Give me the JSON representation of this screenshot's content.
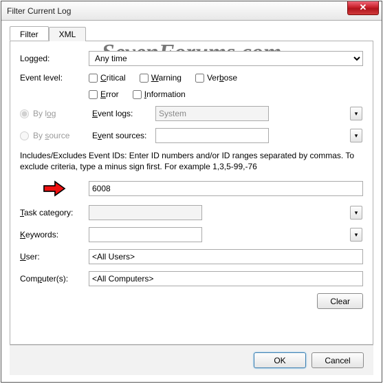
{
  "window": {
    "title": "Filter Current Log"
  },
  "watermark": "SevenForums.com",
  "tabs": {
    "filter": "Filter",
    "xml": "XML"
  },
  "labels": {
    "logged": "Logged:",
    "event_level": "Event level:",
    "by_log": "By log",
    "by_source": "By source",
    "event_logs": "Event logs:",
    "event_sources": "Event sources:",
    "task_category": "Task category:",
    "keywords": "Keywords:",
    "user": "User:",
    "computers": "Computer(s):"
  },
  "logged_value": "Any time",
  "levels": {
    "critical": "Critical",
    "warning": "Warning",
    "verbose": "Verbose",
    "error": "Error",
    "information": "Information"
  },
  "event_logs_value": "System",
  "event_sources_value": "",
  "help_text": "Includes/Excludes Event IDs: Enter ID numbers and/or ID ranges separated by commas. To exclude criteria, type a minus sign first. For example 1,3,5-99,-76",
  "event_id_value": "6008",
  "task_category_value": "",
  "keywords_value": "",
  "user_value": "<All Users>",
  "computers_value": "<All Computers>",
  "buttons": {
    "clear": "Clear",
    "ok": "OK",
    "cancel": "Cancel"
  }
}
